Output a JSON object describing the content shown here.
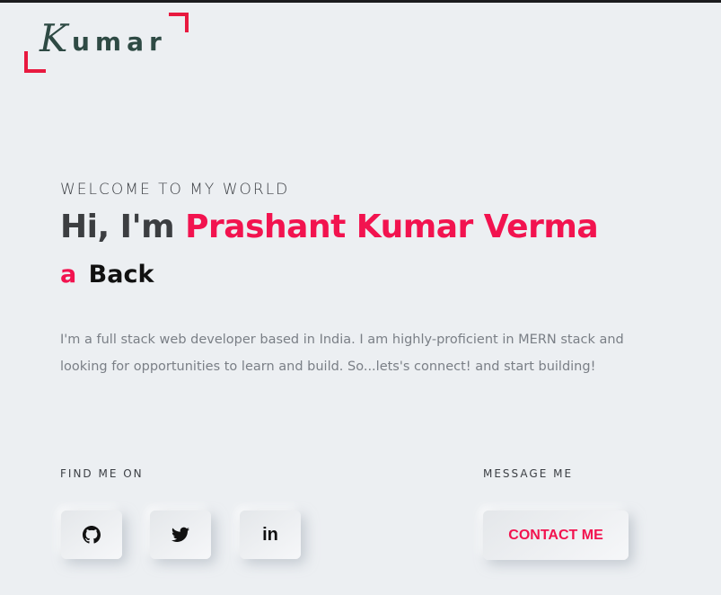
{
  "logo": {
    "initial": "K",
    "rest": "umar"
  },
  "hero": {
    "welcome": "WELCOME TO MY WORLD",
    "greeting": "Hi, I'm",
    "name": "Prashant Kumar Verma",
    "role_article": "a",
    "role": "Back",
    "bio": "I'm a full stack web developer based in India. I am highly-proficient in MERN stack and looking for opportunities to learn and build. So...lets's connect! and start building!"
  },
  "social": {
    "label": "FIND ME ON",
    "items": [
      {
        "icon": "github-icon"
      },
      {
        "icon": "twitter-icon"
      },
      {
        "icon": "linkedin-icon",
        "text": "in"
      }
    ]
  },
  "message": {
    "label": "MESSAGE ME",
    "button": "CONTACT ME"
  },
  "colors": {
    "accent": "#f2134f",
    "logo_frame": "#e8193f",
    "logo_text": "#2e4a44",
    "background": "#eceff2"
  }
}
